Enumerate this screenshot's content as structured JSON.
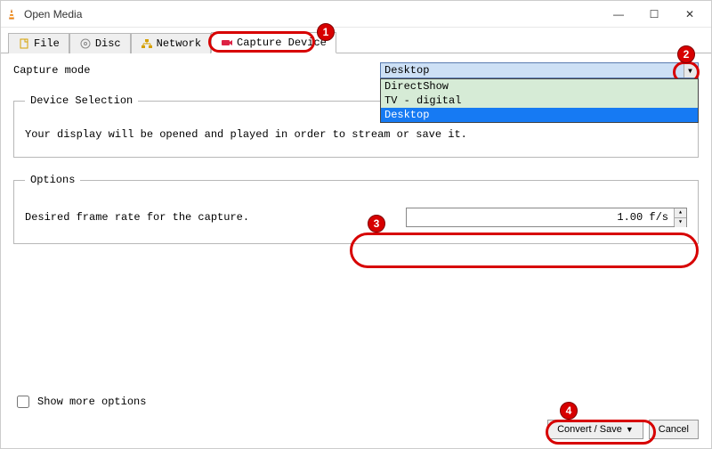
{
  "window": {
    "title": "Open Media"
  },
  "tabs": {
    "file": "File",
    "disc": "Disc",
    "network": "Network",
    "capture": "Capture Device"
  },
  "mode": {
    "label": "Capture mode",
    "selected": "Desktop",
    "options": [
      "DirectShow",
      "TV - digital",
      "Desktop"
    ]
  },
  "device": {
    "legend": "Device Selection",
    "text": "Your display will be opened and played in order to stream or save it."
  },
  "options": {
    "legend": "Options",
    "frame_label": "Desired frame rate for the capture.",
    "frame_value": "1.00 f/s"
  },
  "footer": {
    "show_more": "Show more options",
    "convert": "Convert / Save",
    "cancel": "Cancel"
  },
  "callouts": [
    "1",
    "2",
    "3",
    "4"
  ]
}
